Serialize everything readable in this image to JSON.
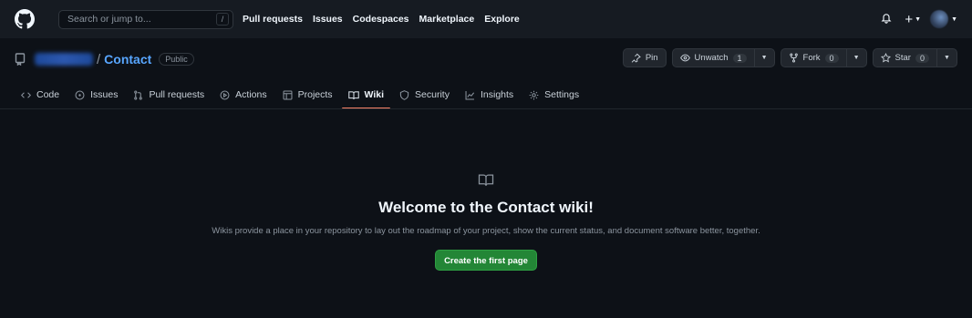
{
  "header": {
    "search_placeholder": "Search or jump to...",
    "search_key": "/",
    "nav": [
      "Pull requests",
      "Issues",
      "Codespaces",
      "Marketplace",
      "Explore"
    ]
  },
  "repo": {
    "separator": "/",
    "name": "Contact",
    "visibility": "Public"
  },
  "actions": {
    "pin": "Pin",
    "unwatch": "Unwatch",
    "unwatch_count": "1",
    "fork": "Fork",
    "fork_count": "0",
    "star": "Star",
    "star_count": "0"
  },
  "tabs": [
    {
      "label": "Code",
      "icon": "code-icon"
    },
    {
      "label": "Issues",
      "icon": "issue-icon"
    },
    {
      "label": "Pull requests",
      "icon": "pull-request-icon"
    },
    {
      "label": "Actions",
      "icon": "play-icon"
    },
    {
      "label": "Projects",
      "icon": "table-icon"
    },
    {
      "label": "Wiki",
      "icon": "book-icon",
      "active": true
    },
    {
      "label": "Security",
      "icon": "shield-icon"
    },
    {
      "label": "Insights",
      "icon": "graph-icon"
    },
    {
      "label": "Settings",
      "icon": "gear-icon"
    }
  ],
  "blankslate": {
    "title": "Welcome to the Contact wiki!",
    "description": "Wikis provide a place in your repository to lay out the roadmap of your project, show the current status, and document software better, together.",
    "button": "Create the first page"
  },
  "colors": {
    "background": "#0d1117",
    "header": "#161b22",
    "link": "#58a6ff",
    "active_tab": "#f78166",
    "primary_button": "#238636"
  }
}
